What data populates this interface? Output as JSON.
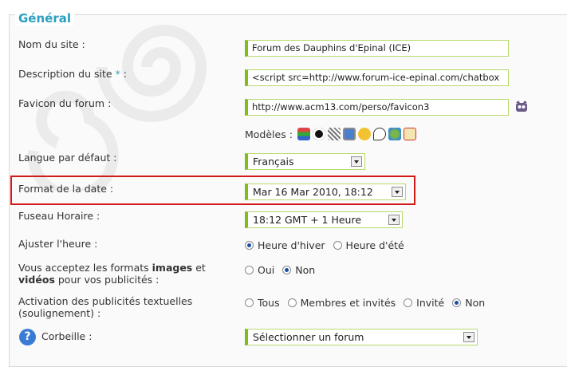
{
  "section": {
    "title": "Général"
  },
  "fields": {
    "site_name": {
      "label": "Nom du site :",
      "value": "Forum des Dauphins d'Epinal (ICE)"
    },
    "site_desc": {
      "label": "Description du site",
      "required_mark": "*",
      "label_suffix": " :",
      "value": "<script src=http://www.forum-ice-epinal.com/chatbox"
    },
    "favicon": {
      "label": "Favicon du forum :",
      "value": "http://www.acm13.com/perso/favicon3"
    },
    "models": {
      "label": "Modèles :",
      "icons": [
        "books-icon",
        "spiral-icon",
        "star-pattern-icon",
        "monitor-icon",
        "smiley-icon",
        "speech-bubble-icon",
        "globe-icon",
        "notepad-icon"
      ]
    },
    "language": {
      "label": "Langue par défaut :",
      "value": "Français"
    },
    "date_format": {
      "label": "Format de la date :",
      "value": "Mar 16 Mar 2010, 18:12"
    },
    "timezone": {
      "label": "Fuseau Horaire :",
      "value": "18:12 GMT + 1 Heure"
    },
    "adjust": {
      "label": "Ajuster l'heure :",
      "options": [
        "Heure d'hiver",
        "Heure d'été"
      ],
      "selected": 0
    },
    "formats": {
      "label_pre": "Vous acceptez les formats ",
      "label_b1": "images",
      "label_mid": " et ",
      "label_b2": "vidéos",
      "label_post": " pour vos publicités :",
      "options": [
        "Oui",
        "Non"
      ],
      "selected": 1
    },
    "textads": {
      "label_line1": "Activation des publicités textuelles",
      "label_line2": "(soulignement) :",
      "options": [
        "Tous",
        "Membres et invités",
        "Invité",
        "Non"
      ],
      "selected": 3
    },
    "trash": {
      "label": "Corbeille :",
      "value": "Sélectionner un forum"
    }
  },
  "colors": {
    "accent": "#7fbc1c",
    "title": "#2a9fbf",
    "highlight": "#d11a1a"
  }
}
